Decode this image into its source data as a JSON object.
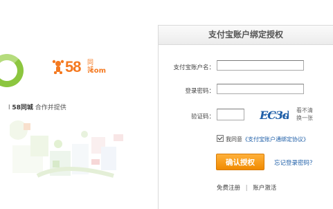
{
  "brand": {
    "number": "58",
    "chinese": "同城",
    "domain": ".com",
    "accent": "#f47920"
  },
  "provider_text": {
    "prefix": "l",
    "name": "58同城",
    "suffix": "合作并提供"
  },
  "panel": {
    "title": "支付宝账户绑定授权",
    "account_label": "支付宝账户名：",
    "account_value": "",
    "password_label": "登录密码：",
    "password_value": "",
    "captcha_label": "验证码：",
    "captcha_value": "",
    "captcha_text": "EC3d",
    "refresh_text": "看不清\n换一张",
    "agree_prefix": "我同意",
    "agree_link": "《支付宝账户通绑定协议》",
    "submit_label": "确认授权",
    "forgot_label": "忘记登录密码？",
    "register_label": "免费注册",
    "separator": "|",
    "activate_label": "账户激活",
    "button_color": "#f08a00",
    "link_color": "#1f5fa8"
  }
}
